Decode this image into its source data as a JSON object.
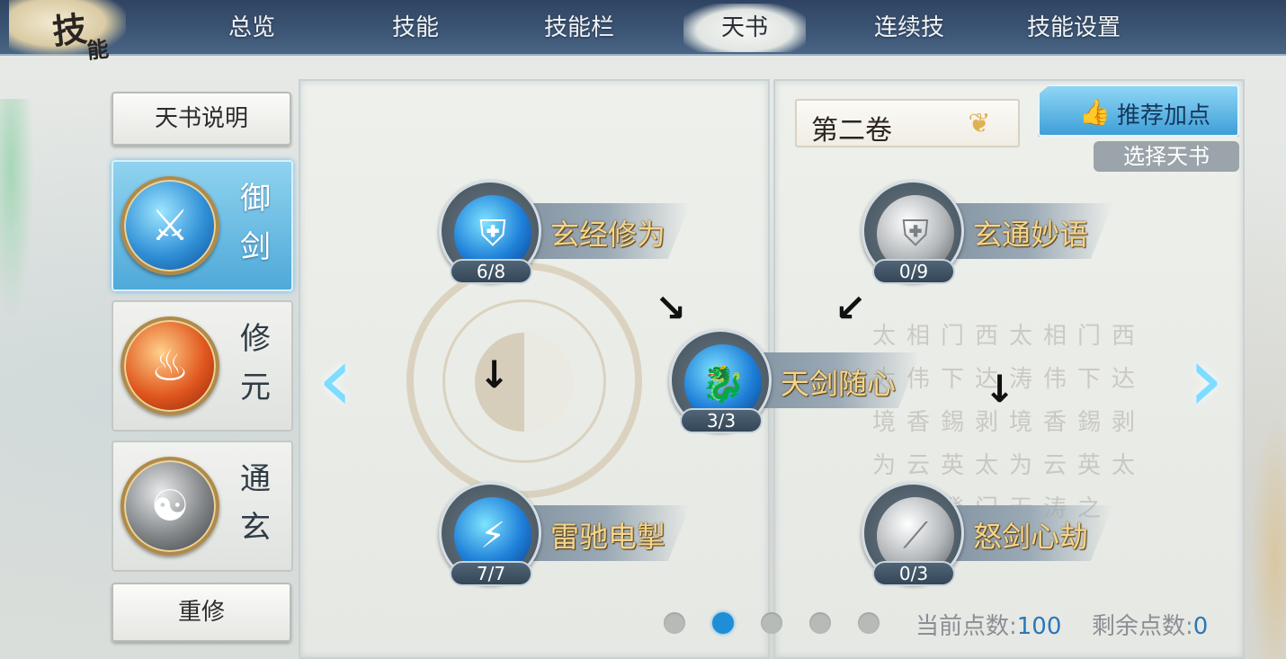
{
  "header": {
    "logo_main": "技",
    "logo_sub": "能",
    "tabs": [
      {
        "label": "总览",
        "active": false
      },
      {
        "label": "技能",
        "active": false
      },
      {
        "label": "技能栏",
        "active": false
      },
      {
        "label": "天书",
        "active": true
      },
      {
        "label": "连续技",
        "active": false
      },
      {
        "label": "技能设置",
        "active": false
      }
    ]
  },
  "sidebar": {
    "explain_label": "天书说明",
    "books": [
      {
        "name_1": "御",
        "name_2": "剑",
        "icon": "sword-emblem-icon",
        "color": "#2f8fd6",
        "active": true
      },
      {
        "name_1": "修",
        "name_2": "元",
        "icon": "flame-emblem-icon",
        "color": "#e0561e",
        "active": false
      },
      {
        "name_1": "通",
        "name_2": "玄",
        "icon": "taiji-sword-icon",
        "color": "#808487",
        "active": false
      }
    ],
    "reset_label": "重修"
  },
  "left_panel": {
    "skills": [
      {
        "name": "玄经修为",
        "level": "6/8",
        "icon": "ice-shield-icon",
        "style": "blue"
      },
      {
        "name": "天剑随心",
        "level": "3/3",
        "icon": "ice-dragon-icon",
        "style": "blue"
      },
      {
        "name": "雷驰电掣",
        "level": "7/7",
        "icon": "lightning-icon",
        "style": "blue"
      }
    ]
  },
  "right_panel": {
    "volume": "第二卷",
    "recommend_label": "推荐加点",
    "choose_label": "选择天书",
    "skills": [
      {
        "name": "玄通妙语",
        "level": "0/9",
        "icon": "shield-icon",
        "style": "grey"
      },
      {
        "name": "怒剑心劫",
        "level": "0/3",
        "icon": "blade-slash-icon",
        "style": "grey"
      }
    ],
    "calligraphy": "太相门西太相门西太伟下达涛伟下达境香錫剥境香錫剥为云英太为云英太无涛登门无涛之"
  },
  "pagination": {
    "count": 5,
    "active_index": 1
  },
  "points": {
    "current_label": "当前点数:",
    "current_value": "100",
    "remaining_label": "剩余点数:",
    "remaining_value": "0"
  },
  "colors": {
    "accent": "#3e9fd6",
    "skill_name": "#f4d58a",
    "nav_bar": "#3d5676"
  }
}
